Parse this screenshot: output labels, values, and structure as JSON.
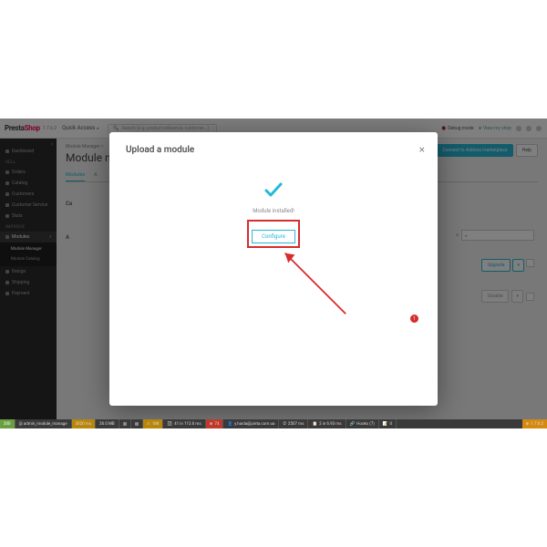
{
  "brand": {
    "presta": "Presta",
    "shop": "Shop",
    "version": "1.7.6.2"
  },
  "topbar": {
    "quick_access": "Quick Access",
    "search_ph": "Search (e.g. product reference, customer...)",
    "debug": "Debug mode",
    "view": "View my shop"
  },
  "sidebar": {
    "dashboard": "Dashboard",
    "sell": "SELL",
    "orders": "Orders",
    "catalog": "Catalog",
    "customers": "Customers",
    "cs": "Customer Service",
    "stats": "Stats",
    "improve": "IMPROVE",
    "modules": "Modules",
    "mm": "Module Manager",
    "mc": "Module Catalog",
    "design": "Design",
    "shipping": "Shipping",
    "payment": "Payment"
  },
  "page": {
    "crumb": "Module Manager >",
    "title": "Module n",
    "addons": "Connect to Addons marketplace",
    "help": "Help",
    "tab_modules": "Modules",
    "tab_alerts": "A",
    "c_label": "Ca",
    "a_label": "A",
    "upgrade": "Upgrade",
    "disable": "Disable"
  },
  "modal": {
    "title": "Upload a module",
    "msg": "Module installed!",
    "configure": "Configure"
  },
  "annot": {
    "num": "1"
  },
  "debug": {
    "code": "200",
    "route": "@ admin_module_manage",
    "t1": "3620 ms",
    "t2": "26.0 MB",
    "q": "188",
    "n41": "41 in 113.6 ms",
    "r74": "74",
    "user": "y.haida@pinta.com.ua",
    "t3": "2507 ms",
    "t4": "2 in 6.93 ms",
    "hooks": "Hooks (7)",
    "l0": "0",
    "ver": "1.7.6.2"
  }
}
